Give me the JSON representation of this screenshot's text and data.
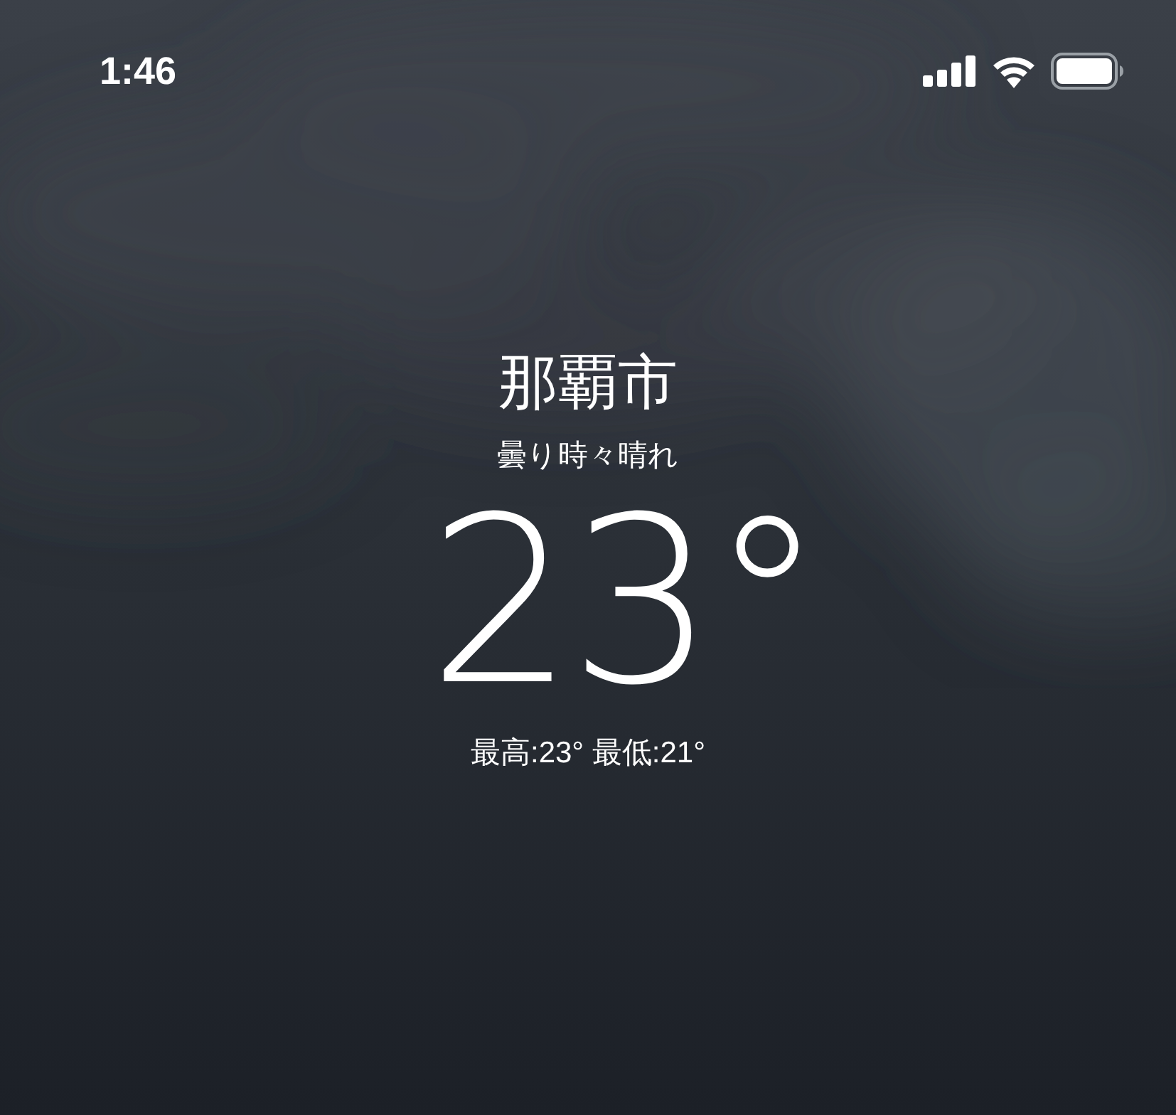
{
  "status_bar": {
    "time": "1:46"
  },
  "weather": {
    "city": "那覇市",
    "condition": "曇り時々晴れ",
    "temperature": "23°",
    "high_low": "最高:23° 最低:21°"
  }
}
